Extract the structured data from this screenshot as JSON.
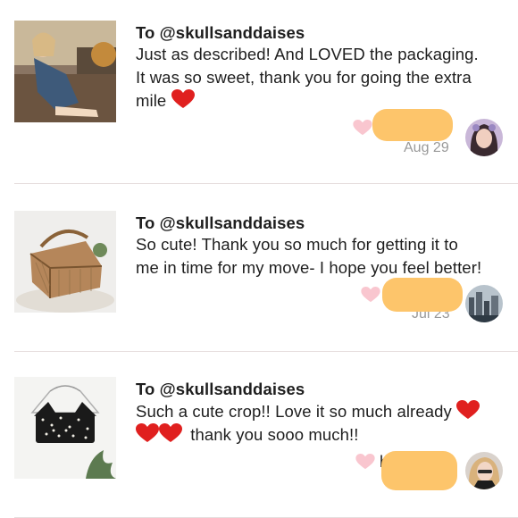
{
  "reviews": [
    {
      "to": "To @skullsanddaises",
      "text_lines": [
        "Just as described! And LOVED the packaging.",
        "It was so sweet, thank you for going the extra",
        "mile"
      ],
      "trailing_emoji": "red-heart",
      "date": "Aug 29",
      "thumbnail": "photo-woman-in-denim-romper",
      "avatar": "photo-girl-filter"
    },
    {
      "to": "To @skullsanddaises",
      "text_lines": [
        "So cute! Thank you so much for getting it to",
        "me in time for my move- I hope you feel better!"
      ],
      "date": "Jul 23",
      "thumbnail": "photo-wicker-picnic-basket",
      "avatar": "photo-city-skyline"
    },
    {
      "to": "To @skullsanddaises",
      "text_lines": [
        "Such a cute crop!! Love it so much already",
        "thank you sooo much!!"
      ],
      "leading_emoji": "red-heart x2",
      "trailing_emoji": "red-heart",
      "partial_text": "h",
      "thumbnail": "photo-floral-crop-top",
      "avatar": "photo-blonde-girl"
    }
  ],
  "colors": {
    "like_heart": "#f9c6cf",
    "redaction": "#fdc56b",
    "emoji_heart": "#e0201f",
    "divider": "#e6dede",
    "date": "#9a9a9a"
  }
}
